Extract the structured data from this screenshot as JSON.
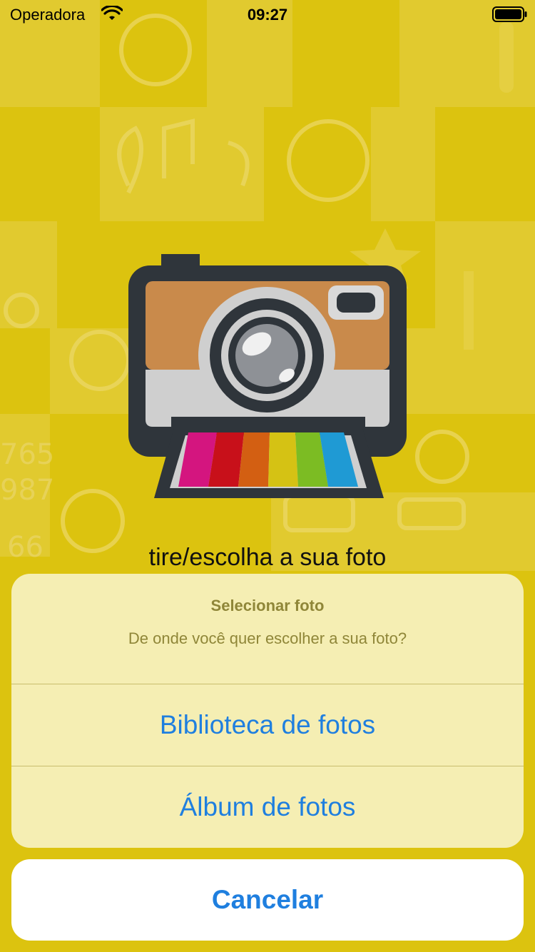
{
  "status_bar": {
    "carrier": "Operadora",
    "time": "09:27",
    "icons": [
      "wifi-icon",
      "battery-icon"
    ]
  },
  "main": {
    "illustration": "camera-illustration",
    "subtitle": "tire/escolha a sua foto"
  },
  "action_sheet": {
    "title": "Selecionar foto",
    "message": "De onde você quer escolher a sua foto?",
    "actions": [
      {
        "label": "Biblioteca de fotos"
      },
      {
        "label": "Álbum de fotos"
      }
    ],
    "cancel_label": "Cancelar"
  },
  "colors": {
    "background": "#dcc30f",
    "accent": "#1f7fdf",
    "sheet_text": "#8f8638",
    "camera_body": "#2f353b",
    "camera_top": "#c98a4b"
  }
}
